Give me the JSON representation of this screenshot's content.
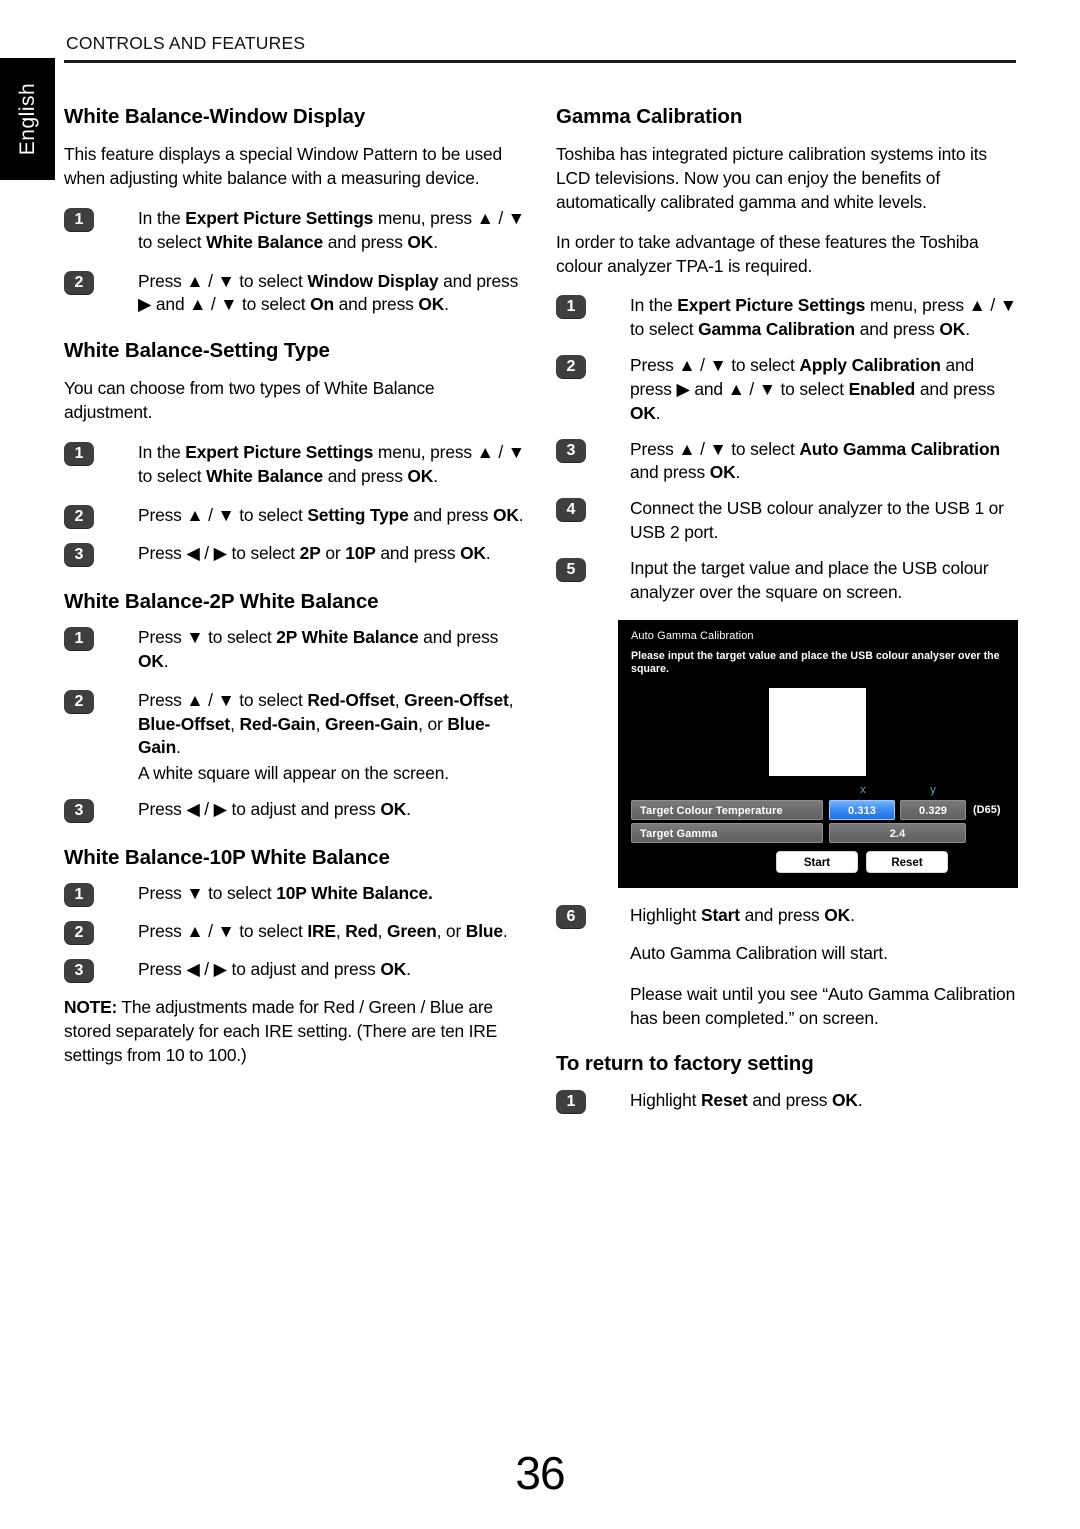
{
  "header": {
    "title": "CONTROLS AND FEATURES",
    "language_tab": "English"
  },
  "footer": {
    "page_number": "36"
  },
  "left_column": {
    "section1": {
      "heading": "White Balance-Window Display",
      "intro": "This feature displays a special Window Pattern to be used when adjusting white balance with a measuring device.",
      "steps": [
        {
          "num": "1",
          "text_html": "In the <b>Expert Picture Settings</b> menu, press ▲ / ▼ to select <b>White Balance</b> and press <b>OK</b>."
        },
        {
          "num": "2",
          "text_html": "Press ▲ / ▼ to select <b>Window Display</b> and press ▶ and ▲ / ▼ to select <b>On</b> and press <b>OK</b>."
        }
      ]
    },
    "section2": {
      "heading": "White Balance-Setting Type",
      "intro": "You can choose from two types of White Balance adjustment.",
      "steps": [
        {
          "num": "1",
          "text_html": "In the <b>Expert Picture Settings</b> menu, press ▲ / ▼ to select <b>White Balance</b> and press <b>OK</b>."
        },
        {
          "num": "2",
          "text_html": "Press ▲ / ▼ to select <b>Setting Type</b> and press <b>OK</b>."
        },
        {
          "num": "3",
          "text_html": "Press ◀ / ▶ to select <b>2P</b> or <b>10P</b> and press <b>OK</b>."
        }
      ]
    },
    "section3": {
      "heading": "White Balance-2P White Balance",
      "steps": [
        {
          "num": "1",
          "text_html": "Press ▼ to select <b>2P White Balance</b> and press <b>OK</b>."
        },
        {
          "num": "2",
          "text_html": "Press ▲ / ▼ to select <b>Red-Offset</b>, <b>Green-Offset</b>, <b>Blue-Offset</b>, <b>Red-Gain</b>, <b>Green-Gain</b>, or <b>Blue-Gain</b>.",
          "sub_text": "A white square will appear on the screen."
        },
        {
          "num": "3",
          "text_html": "Press ◀ / ▶ to adjust and press <b>OK</b>."
        }
      ]
    },
    "section4": {
      "heading": "White Balance-10P White Balance",
      "steps": [
        {
          "num": "1",
          "text_html": "Press ▼ to select <b>10P White Balance.</b>"
        },
        {
          "num": "2",
          "text_html": "Press ▲ / ▼ to select <b>IRE</b>, <b>Red</b>, <b>Green</b>, or <b>Blue</b>."
        },
        {
          "num": "3",
          "text_html": "Press ◀ / ▶ to adjust and press <b>OK</b>."
        }
      ],
      "note_html": "<b>NOTE:</b> The adjustments made for Red / Green / Blue are stored separately for each IRE setting. (There are ten IRE settings from 10 to 100.)"
    }
  },
  "right_column": {
    "section1": {
      "heading": "Gamma Calibration",
      "paragraphs": [
        "Toshiba has integrated picture calibration systems into its LCD televisions. Now you can enjoy the benefits of automatically calibrated gamma and white levels.",
        "In order to take advantage of these features the Toshiba colour analyzer TPA-1 is required."
      ],
      "steps": [
        {
          "num": "1",
          "text_html": "In the <b>Expert Picture Settings</b> menu, press ▲ / ▼ to select <b>Gamma Calibration</b> and press <b>OK</b>."
        },
        {
          "num": "2",
          "text_html": "Press ▲ / ▼ to select <b>Apply Calibration</b> and press ▶ and ▲ / ▼ to select <b>Enabled</b> and press <b>OK</b>."
        },
        {
          "num": "3",
          "text_html": "Press ▲ / ▼ to select <b>Auto Gamma Calibration</b> and press <b>OK</b>."
        },
        {
          "num": "4",
          "text_html": "Connect the USB colour analyzer to the USB 1 or USB 2 port."
        },
        {
          "num": "5",
          "text_html": "Input the target value and place the USB colour analyzer over the square on screen."
        }
      ],
      "steps_after_screen": [
        {
          "num": "6",
          "text_html": "Highlight <b>Start</b> and press <b>OK</b>."
        }
      ],
      "after_screen_paragraphs": [
        "Auto Gamma Calibration will start.",
        "Please wait until you see “Auto Gamma Calibration has been completed.” on screen."
      ]
    },
    "tv_screen": {
      "title": "Auto Gamma Calibration",
      "instruction": "Please input the target value and place the USB colour analyser over the square.",
      "axis_headers": {
        "x": "x",
        "y": "y"
      },
      "rows": [
        {
          "label": "Target Colour Temperature",
          "x_value": "0.313",
          "y_value": "0.329",
          "suffix": "(D65)"
        },
        {
          "label": "Target Gamma",
          "value": "2.4"
        }
      ],
      "buttons": {
        "start": "Start",
        "reset": "Reset"
      },
      "colors": {
        "screen_background": "#000000",
        "cell_gray": "#6b6b6b",
        "selected_blue": "#3d8ef5",
        "axis_cyan": "#3fb6d8",
        "button_white": "#ffffff"
      }
    },
    "section2": {
      "heading": "To return to factory setting",
      "steps": [
        {
          "num": "1",
          "text_html": "Highlight <b>Reset</b> and press <b>OK</b>."
        }
      ]
    }
  }
}
